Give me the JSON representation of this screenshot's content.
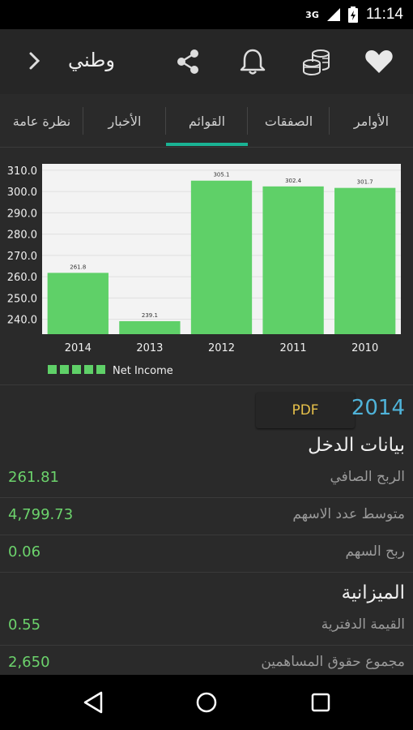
{
  "status": {
    "network": "3G",
    "time": "11:14"
  },
  "toolbar": {
    "title": "وطني",
    "icons": [
      "chevron-right-icon",
      "share-icon",
      "bell-icon",
      "coins-icon",
      "heart-icon"
    ]
  },
  "tabs": [
    {
      "label": "نظرة عامة"
    },
    {
      "label": "الأخبار"
    },
    {
      "label": "القوائم",
      "active": true
    },
    {
      "label": "الصفقات"
    },
    {
      "label": "الأوامر"
    }
  ],
  "chart_data": {
    "type": "bar",
    "categories": [
      "2014",
      "2013",
      "2012",
      "2011",
      "2010"
    ],
    "series": [
      {
        "name": "Net Income",
        "values": [
          261.8,
          239.1,
          305.1,
          302.4,
          301.7
        ]
      }
    ],
    "value_labels": [
      "261.8",
      "239.1",
      "305.1",
      "302.4",
      "301.7"
    ],
    "yticks": [
      "310.0",
      "300.0",
      "290.0",
      "280.0",
      "270.0",
      "260.0",
      "250.0",
      "240.0"
    ],
    "ylim": [
      233,
      313
    ],
    "bar_color": "#5fd068",
    "legend": "bottom-left"
  },
  "year_row": {
    "pdf_label": "PDF",
    "year": "2014"
  },
  "income": {
    "title": "بيانات الدخل",
    "rows": [
      {
        "label": "الربح الصافي",
        "value": "261.81"
      },
      {
        "label": "متوسط عدد الاسهم",
        "value": "4,799.73"
      },
      {
        "label": "ربح السهم",
        "value": "0.06"
      }
    ]
  },
  "balance": {
    "title": "الميزانية",
    "rows": [
      {
        "label": "القيمة الدفترية",
        "value": "0.55"
      },
      {
        "label": "مجموع حقوق المساهمين",
        "value": "2,650"
      }
    ]
  },
  "colors": {
    "accent": "#1ab394",
    "value_green": "#6cd36c",
    "year_blue": "#4fb3d9",
    "pdf_yellow": "#e6c04a"
  }
}
